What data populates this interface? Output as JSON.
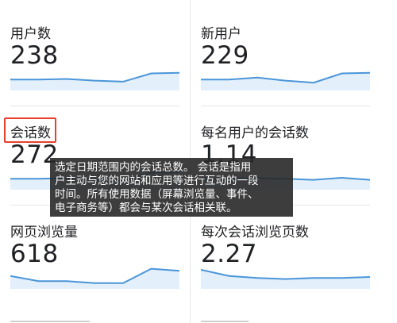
{
  "metrics": [
    {
      "id": "users",
      "label": "用户数",
      "value": "238",
      "trend": [
        0.55,
        0.55,
        0.52,
        0.6,
        0.65,
        0.25,
        0.22
      ]
    },
    {
      "id": "new_users",
      "label": "新用户",
      "value": "229",
      "trend": [
        0.55,
        0.55,
        0.45,
        0.6,
        0.7,
        0.25,
        0.22
      ]
    },
    {
      "id": "sessions",
      "label": "会话数",
      "value": "272",
      "trend": [
        0.55,
        0.55,
        0.52,
        0.6,
        0.65,
        0.25,
        0.22
      ]
    },
    {
      "id": "sessions_per_user",
      "label": "每名用户的会话数",
      "value": "1.14",
      "trend": [
        0.55,
        0.55,
        0.52,
        0.55,
        0.6,
        0.5,
        0.6
      ]
    },
    {
      "id": "pageviews",
      "label": "网页浏览量",
      "value": "618",
      "trend": [
        0.45,
        0.7,
        0.7,
        0.8,
        0.8,
        0.1,
        0.2
      ]
    },
    {
      "id": "pages_per_session",
      "label": "每次会话浏览页数",
      "value": "2.27",
      "trend": [
        0.15,
        0.45,
        0.55,
        0.6,
        0.55,
        0.55,
        0.5
      ]
    }
  ],
  "tooltip": {
    "line1": "选定日期范围内的会话总数。 会话是指用",
    "line2": "户主动与您的网站和应用等进行互动的一段",
    "line3": "时间。所有使用数据（屏幕浏览量、事件、",
    "line4": "电子商务等）都会与某次会话相关联。"
  },
  "colors": {
    "line": "#4a95d8",
    "fill": "#e3f0fb",
    "highlight": "#e8402f"
  }
}
